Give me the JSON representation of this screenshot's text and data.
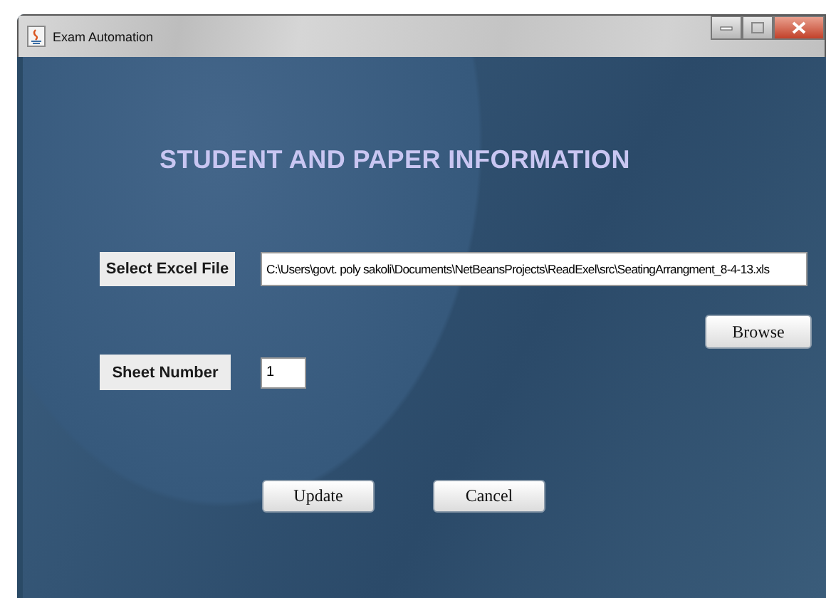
{
  "window": {
    "title": "Exam Automation"
  },
  "heading": "STUDENT AND PAPER INFORMATION",
  "excel_file": {
    "label": "Select Excel File",
    "value": "C:\\Users\\govt. poly sakoli\\Documents\\NetBeansProjects\\ReadExel\\src\\SeatingArrangment_8-4-13.xls",
    "button": "Browse"
  },
  "sheet": {
    "label": "Sheet Number",
    "value": "1"
  },
  "buttons": [
    "Update",
    "Cancel"
  ]
}
